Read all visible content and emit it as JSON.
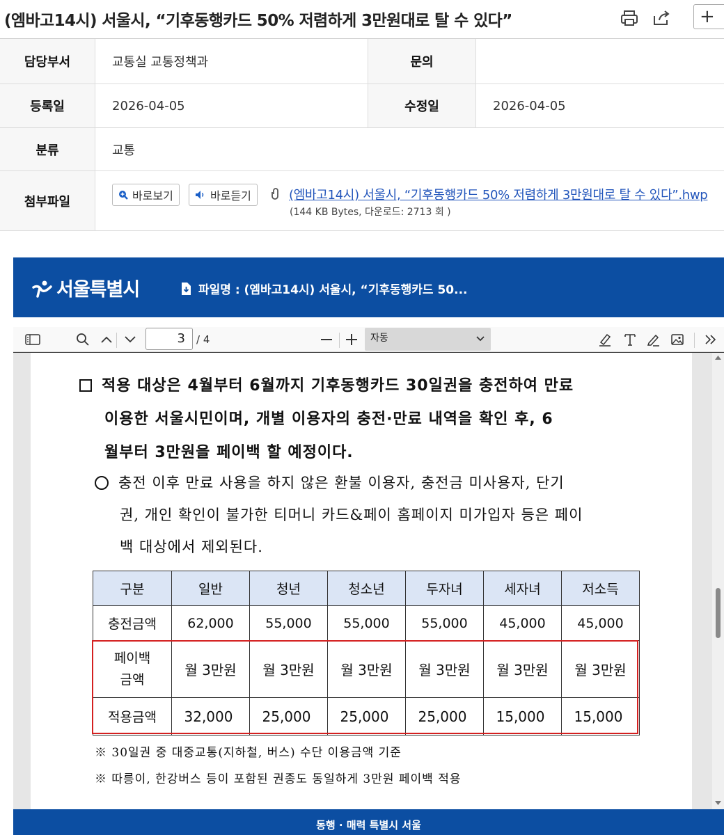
{
  "header": {
    "title": "(엠바고14시) 서울시, “기후동행카드 50% 저렴하게 3만원대로 탈 수 있다”",
    "icons": [
      "print-icon",
      "share-icon",
      "plus-icon"
    ]
  },
  "info": {
    "dept_label": "담당부서",
    "dept_value": "교통실 교통정책과",
    "contact_label": "문의",
    "contact_value": "",
    "reg_label": "등록일",
    "reg_value": "2026-04-05",
    "mod_label": "수정일",
    "mod_value": "2026-04-05",
    "category_label": "분류",
    "category_value": "교통",
    "attach_label": "첨부파일",
    "view_button": "바로보기",
    "listen_button": "바로듣기",
    "file_name": "(엠바고14시) 서울시, “기후동행카드 50% 저렴하게 3만원대로 탈 수 있다”.hwp",
    "file_meta": "(144 KB Bytes, 다운로드: 2713 회 )"
  },
  "viewer": {
    "logo": "서울특별시",
    "file_label": "파일명 : (엠바고14시) 서울시, “기후동행카드 50...",
    "page_current": "3",
    "page_total": "/ 4",
    "zoom": "자동",
    "footer": "동행 · 매력 특별시 서울"
  },
  "doc": {
    "para1_line1": "적용 대상은 4월부터 6월까지 기후동행카드 30일권을 충전하여 만료",
    "para1_line2": "이용한 서울시민이며, 개별 이용자의 충전·만료 내역을 확인 후, 6",
    "para1_line3": "월부터 3만원을 페이백 할 예정이다.",
    "para2_line1": "충전 이후 만료 사용을 하지 않은 환불 이용자, 충전금 미사용자, 단기",
    "para2_line2": "권, 개인 확인이 불가한 티머니 카드&페이 홈페이지 미가입자 등은 페이",
    "para2_line3": "백 대상에서 제외된다.",
    "table": {
      "headers": [
        "구분",
        "일반",
        "청년",
        "청소년",
        "두자녀",
        "세자녀",
        "저소득"
      ],
      "charge_label": "충전금액",
      "charge": [
        "62,000",
        "55,000",
        "55,000",
        "55,000",
        "45,000",
        "45,000"
      ],
      "payback_label_1": "페이백",
      "payback_label_2": "금액",
      "payback": [
        "월 3만원",
        "월 3만원",
        "월 3만원",
        "월 3만원",
        "월 3만원",
        "월 3만원"
      ],
      "apply_label": "적용금액",
      "apply": [
        "32,000",
        "25,000",
        "25,000",
        "25,000",
        "15,000",
        "15,000"
      ]
    },
    "note1": "※ 30일권 중 대중교통(지하철, 버스) 수단 이용금액 기준",
    "note2": "※ 따릉이, 한강버스 등이 포함된 권종도 동일하게 3만원 페이백 적용"
  },
  "colors": {
    "brand_blue": "#0c4ea2",
    "table_header": "#dbe5f5",
    "highlight_red": "#d42020",
    "link": "#2255bb"
  }
}
